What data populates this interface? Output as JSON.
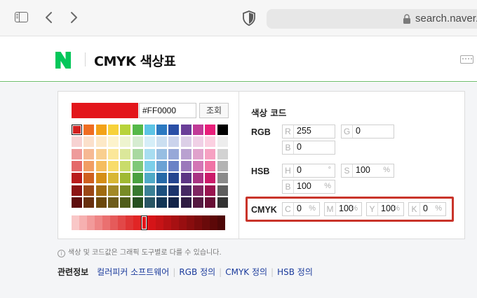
{
  "browser": {
    "url": "search.naver.com"
  },
  "header": {
    "logo": "N",
    "title": "CMYK 색상표"
  },
  "picker": {
    "hex_value": "#FF0000",
    "lookup_label": "조회",
    "preview_color": "#e3161b",
    "palette_rows": [
      [
        "#d21e1e",
        "#ef6d22",
        "#f3a218",
        "#f7d13a",
        "#b8d33b",
        "#55b849",
        "#5dc4e4",
        "#2b79c1",
        "#2a4fa6",
        "#6a3f98",
        "#c13b97",
        "#e81f7a",
        "#000000"
      ],
      [
        "#f7d2d2",
        "#fbe0cb",
        "#fde9c7",
        "#fdf3cc",
        "#eef4cf",
        "#d6ecd1",
        "#d5eef8",
        "#cbdff1",
        "#cbd3ec",
        "#dccfe7",
        "#f0d0e6",
        "#fbd0e1",
        "#ededed"
      ],
      [
        "#ee9b9b",
        "#f6b993",
        "#f9cf8f",
        "#fbe799",
        "#dbe79a",
        "#a8d8a0",
        "#a8ddf0",
        "#97bee2",
        "#97a8d8",
        "#b9a1d0",
        "#e0a2cc",
        "#f6a1c2",
        "#d2d2d2"
      ],
      [
        "#e46a6a",
        "#f19e64",
        "#f5bd5f",
        "#f8dc6a",
        "#c9dc6b",
        "#7fc878",
        "#7ccfe9",
        "#6ba2d4",
        "#6a82c6",
        "#9b79bb",
        "#d376b5",
        "#f073a5",
        "#b3b3b3"
      ],
      [
        "#b91b1b",
        "#cf5f1e",
        "#d58e16",
        "#d8b733",
        "#a0b933",
        "#4aa140",
        "#4faac6",
        "#2569a8",
        "#244590",
        "#5c3684",
        "#a93383",
        "#cb1b6a",
        "#8a8a8a"
      ],
      [
        "#8c1414",
        "#9b4716",
        "#a06b10",
        "#a28926",
        "#788b26",
        "#387930",
        "#3b8095",
        "#1c4f7e",
        "#1b346c",
        "#452963",
        "#7f2662",
        "#99144f",
        "#5e5e5e"
      ],
      [
        "#5e0d0d",
        "#68300f",
        "#6b480b",
        "#6d5c1a",
        "#505d1a",
        "#254f20",
        "#285564",
        "#123555",
        "#122348",
        "#2e1b42",
        "#551941",
        "#670e35",
        "#333333"
      ]
    ],
    "shade_bar": [
      "#f9c7c7",
      "#f6b0b0",
      "#f29a9a",
      "#ee8585",
      "#ea7070",
      "#e55b5b",
      "#e24848",
      "#df3535",
      "#e12525",
      "#e3161b",
      "#d51418",
      "#c61316",
      "#b61114",
      "#a71012",
      "#980e10",
      "#880d0e",
      "#790b0c",
      "#6a0a0a",
      "#5c0808",
      "#4e0707"
    ],
    "shade_selected_index": 9
  },
  "codes": {
    "title": "색상 코드",
    "rgb": {
      "label": "RGB",
      "r_ch": "R",
      "r": "255",
      "g_ch": "G",
      "g": "0",
      "b_ch": "B",
      "b": "0"
    },
    "hsb": {
      "label": "HSB",
      "h_ch": "H",
      "h": "0",
      "h_unit": "°",
      "s_ch": "S",
      "s": "100",
      "s_unit": "%",
      "b_ch": "B",
      "b": "100",
      "b_unit": "%"
    },
    "cmyk": {
      "label": "CMYK",
      "c_ch": "C",
      "c": "0",
      "c_unit": "%",
      "m_ch": "M",
      "m": "100",
      "m_unit": "%",
      "y_ch": "Y",
      "y": "100",
      "y_unit": "%",
      "k_ch": "K",
      "k": "0",
      "k_unit": "%"
    }
  },
  "note": {
    "icon": "i",
    "text": "색상 및 코드값은 그래픽 도구별로 다를 수 있습니다."
  },
  "related": {
    "label": "관련정보",
    "links": [
      "컬러피커 소프트웨어",
      "RGB 정의",
      "CMYK 정의",
      "HSB 정의"
    ]
  },
  "colors": {
    "highlight": "#c9342a",
    "naver_green": "#03c75a",
    "link": "#1b3b9c"
  }
}
